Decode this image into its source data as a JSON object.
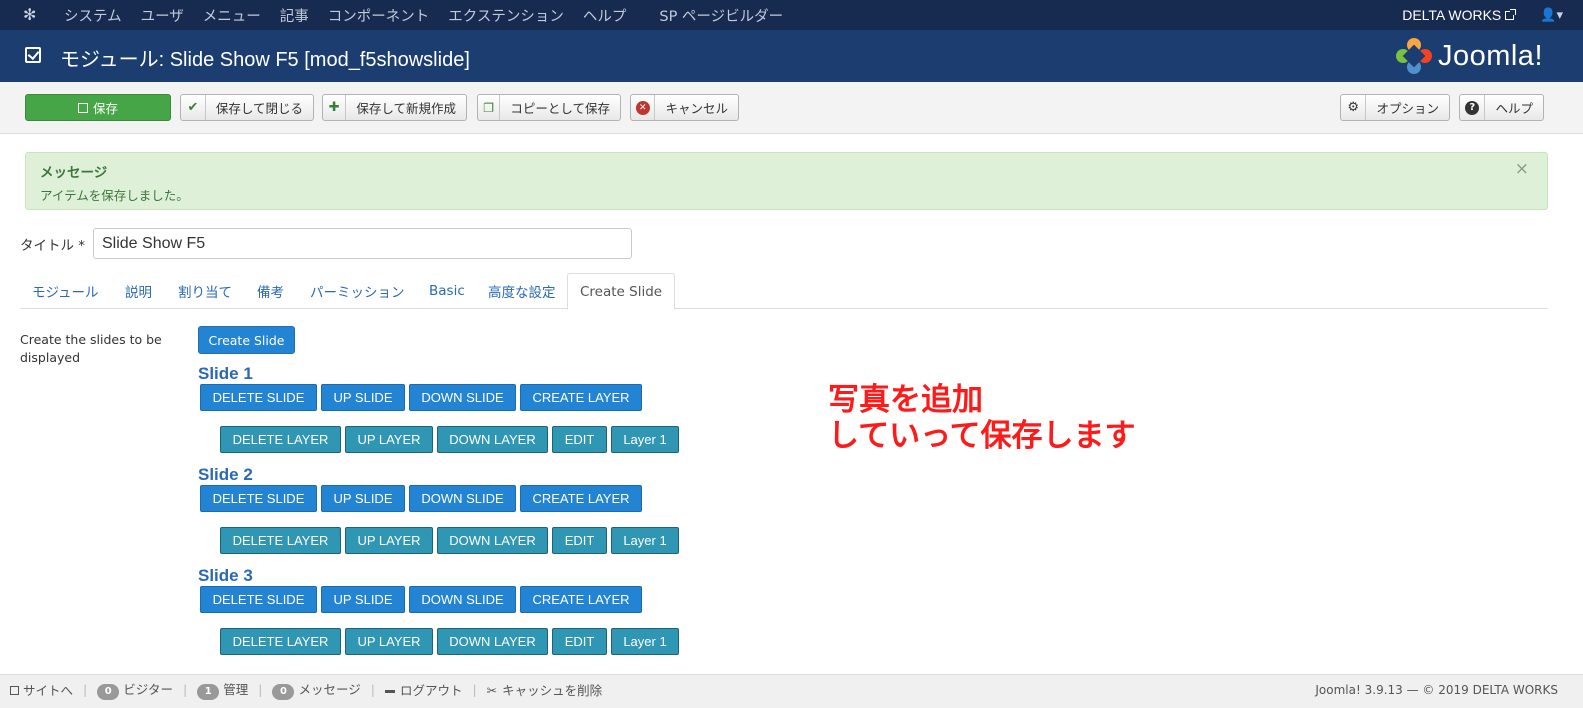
{
  "topnav": {
    "menu": [
      "システム",
      "ユーザ",
      "メニュー",
      "記事",
      "コンポーネント",
      "エクステンション",
      "ヘルプ",
      "SP ページビルダー"
    ],
    "site_name": "DELTA WORKS"
  },
  "header": {
    "title": "モジュール: Slide Show F5 [mod_f5showslide]",
    "brand": "Joomla!"
  },
  "toolbar": {
    "save": "保存",
    "save_close": "保存して閉じる",
    "save_new": "保存して新規作成",
    "save_copy": "コピーとして保存",
    "cancel": "キャンセル",
    "options": "オプション",
    "help": "ヘルプ"
  },
  "alert": {
    "heading": "メッセージ",
    "message": "アイテムを保存しました。",
    "close": "×"
  },
  "form": {
    "title_label": "タイトル *",
    "title_value": "Slide Show F5"
  },
  "tabs": [
    "モジュール",
    "説明",
    "割り当て",
    "備考",
    "パーミッション",
    "Basic",
    "高度な設定",
    "Create Slide"
  ],
  "create_slide": {
    "description": "Create the slides to be displayed",
    "button": "Create Slide",
    "slides": [
      {
        "title": "Slide 1",
        "layer": "Layer 1"
      },
      {
        "title": "Slide 2",
        "layer": "Layer 1"
      },
      {
        "title": "Slide 3",
        "layer": "Layer 1"
      }
    ],
    "slide_buttons": [
      "DELETE SLIDE",
      "UP SLIDE",
      "DOWN SLIDE",
      "CREATE LAYER"
    ],
    "layer_buttons": [
      "DELETE LAYER",
      "UP LAYER",
      "DOWN LAYER",
      "EDIT"
    ]
  },
  "annotation": {
    "line1": "写真を追加",
    "line2": "していって保存します"
  },
  "statusbar": {
    "site": "サイトへ",
    "visitors_count": "0",
    "visitors": "ビジター",
    "admin_count": "1",
    "admin": "管理",
    "messages_count": "0",
    "messages": "メッセージ",
    "logout": "ログアウト",
    "clear_cache": "キャッシュを削除",
    "version": "Joomla! 3.9.13 — © 2019 DELTA WORKS"
  }
}
